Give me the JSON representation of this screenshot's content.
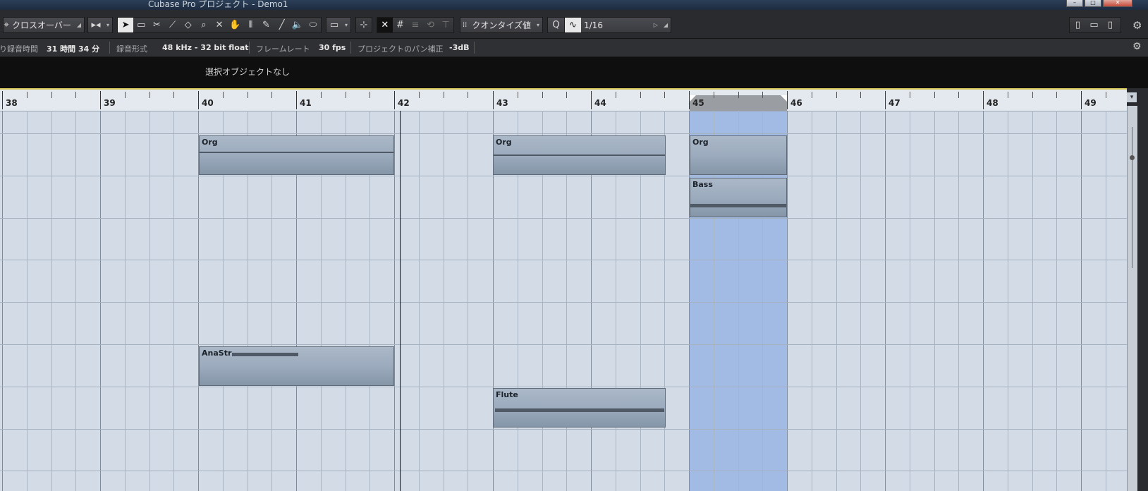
{
  "window": {
    "title": "Cubase Pro プロジェクト - Demo1"
  },
  "toolbar": {
    "crossover_label": "クロスオーバー",
    "quantize_mode_label": "クオンタイズ値",
    "quantize_q": "Q",
    "quantize_value": "1/16"
  },
  "info_line": {
    "rec_time_label": "残り録音時間",
    "rec_time_value": "31 時間 34 分",
    "rec_format_label": "録音形式",
    "rec_format_value": "48 kHz - 32 bit float",
    "frame_rate_label": "フレームレート",
    "frame_rate_value": "30 fps",
    "pan_label": "プロジェクトのパン補正",
    "pan_value": "-3dB"
  },
  "info_strip": {
    "text": "選択オブジェクトなし"
  },
  "ruler": {
    "bars": [
      "38",
      "39",
      "40",
      "41",
      "42",
      "43",
      "44",
      "45",
      "46",
      "47",
      "48",
      "49"
    ]
  },
  "events": [
    {
      "name": "Org",
      "track": 1
    },
    {
      "name": "Org",
      "track": 1
    },
    {
      "name": "Org",
      "track": 1
    },
    {
      "name": "Bass",
      "track": 2
    },
    {
      "name": "AnaStr",
      "track": 6
    },
    {
      "name": "Flute",
      "track": 7
    }
  ],
  "colors": {
    "loop_range": "#8fb0e6",
    "event_fill": "#9cabbd",
    "grid_bg": "#d3dbe6"
  }
}
